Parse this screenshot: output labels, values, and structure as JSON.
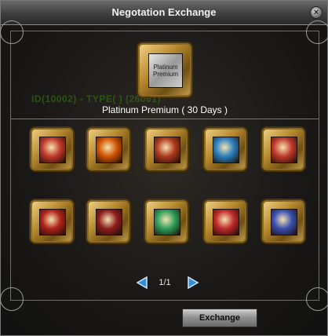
{
  "window": {
    "title": "Negotation Exchange",
    "close_icon": "close-icon"
  },
  "background_text": "ID(10002) - TYPE(     ) (26061)",
  "featured": {
    "icon_text": "Platinum Premium",
    "name": "Platinum Premium ( 30 Days )"
  },
  "items": [
    {
      "icon": "red-scroll-icon",
      "color": "#c0392b"
    },
    {
      "icon": "orange-scroll-icon",
      "color": "#d35400"
    },
    {
      "icon": "red-gold-scroll-icon",
      "color": "#b03a1e"
    },
    {
      "icon": "blue-sword-icon",
      "color": "#2a7fbf"
    },
    {
      "icon": "red-glove-icon",
      "color": "#c0392b"
    },
    {
      "icon": "red-gem-badge-icon",
      "color": "#b0221a"
    },
    {
      "icon": "red-ring-icon",
      "color": "#8e1d1d"
    },
    {
      "icon": "green-figure-icon",
      "color": "#2e9e5a"
    },
    {
      "icon": "red-potion-icon",
      "color": "#c0292b"
    },
    {
      "icon": "blue-orb-icon",
      "color": "#3a4fb0"
    }
  ],
  "pagination": {
    "text": "1/1",
    "prev_icon": "prev-arrow-icon",
    "next_icon": "next-arrow-icon"
  },
  "exchange_button": {
    "label": "Exchange"
  },
  "colors": {
    "gold": "#c9a452",
    "arrow": "#2f8fd8"
  }
}
